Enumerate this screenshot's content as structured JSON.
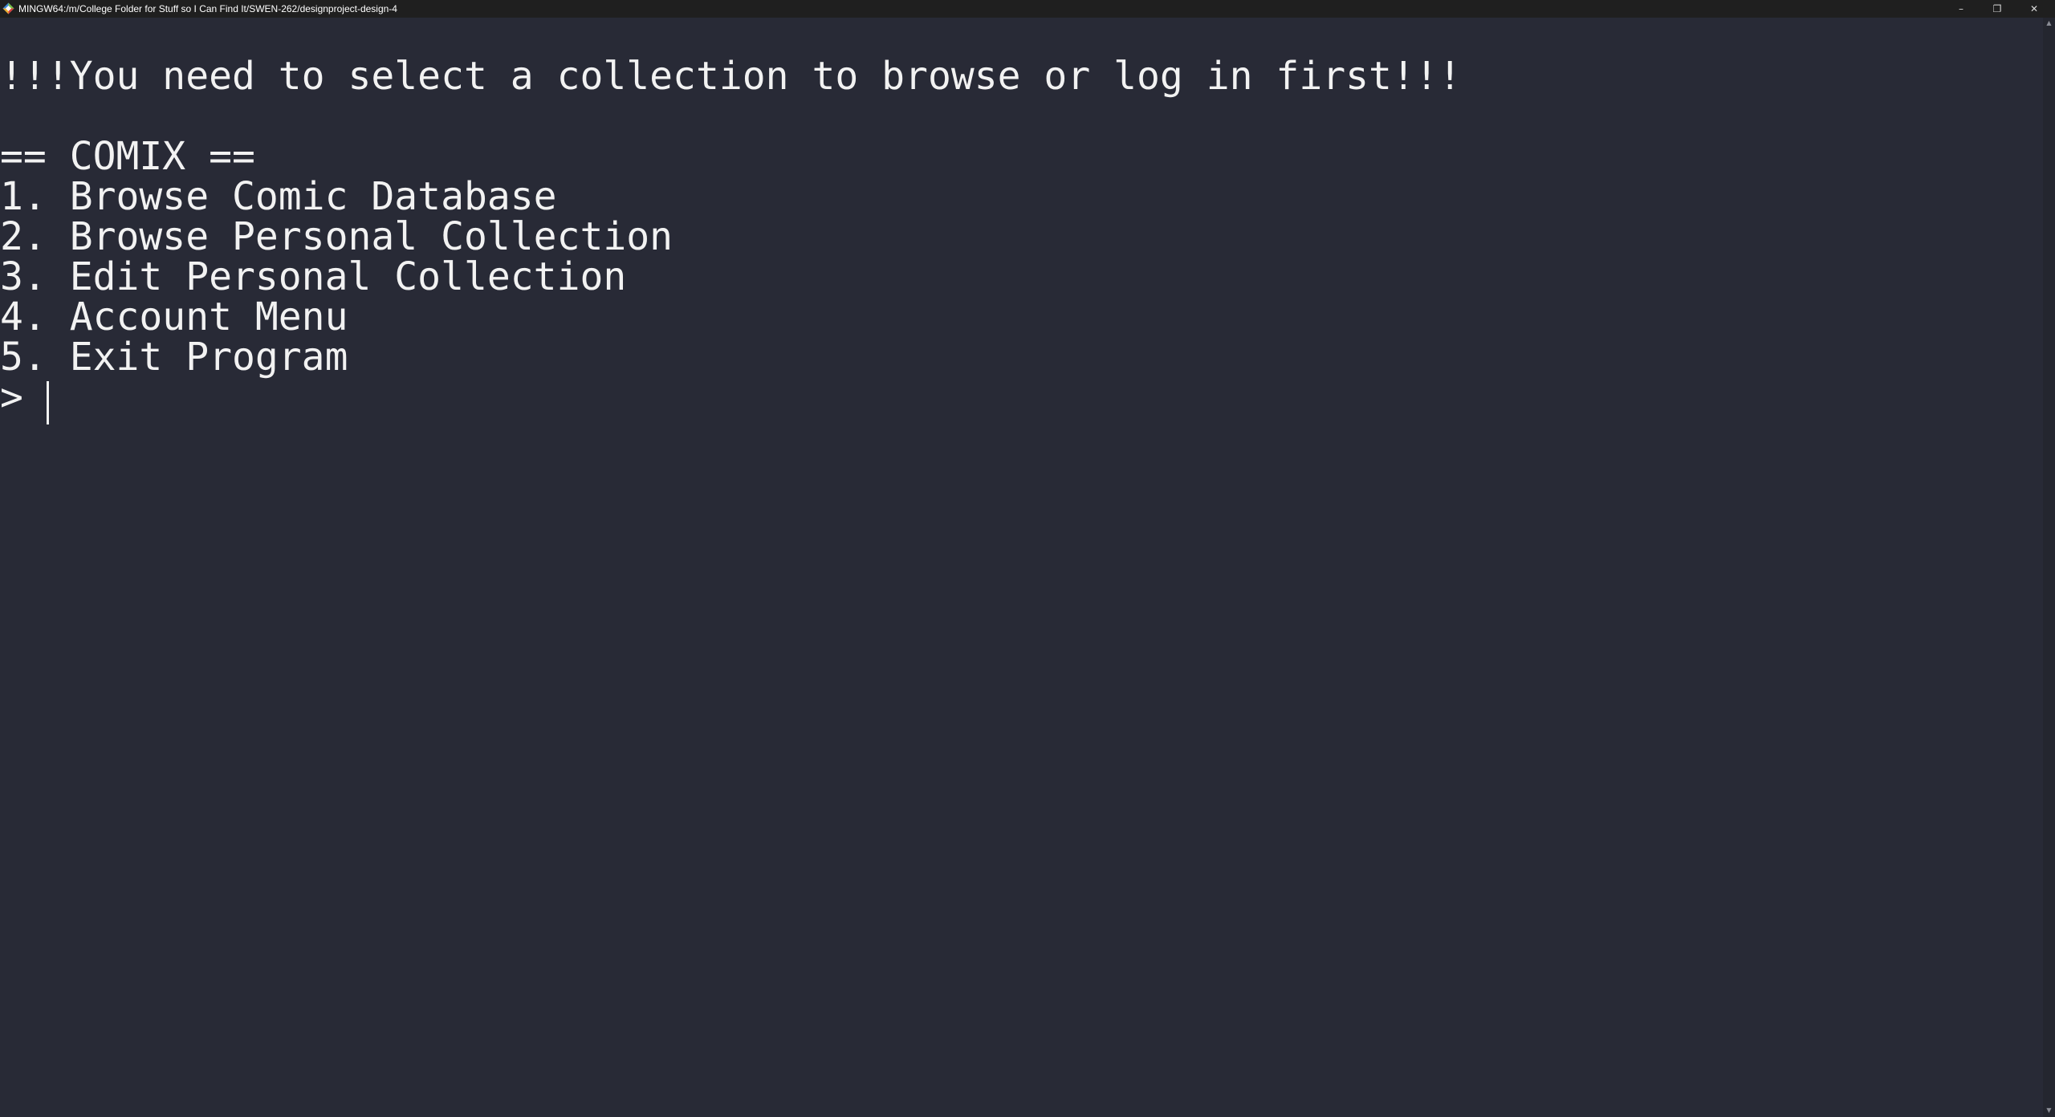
{
  "window": {
    "title": "MINGW64:/m/College Folder for Stuff so I Can Find It/SWEN-262/designproject-design-4",
    "app_icon": "mingw-icon",
    "controls": {
      "minimize": "–",
      "maximize": "❐",
      "close": "✕"
    }
  },
  "terminal": {
    "lines": [
      "!!!You need to select a collection to browse or log in first!!!",
      "",
      "== COMIX ==",
      "1. Browse Comic Database",
      "2. Browse Personal Collection",
      "3. Edit Personal Collection",
      "4. Account Menu",
      "5. Exit Program",
      "> "
    ],
    "colors": {
      "background": "#282a36",
      "foreground": "#f2f2f2"
    }
  },
  "scrollbar": {
    "up": "▲",
    "down": "▼"
  }
}
